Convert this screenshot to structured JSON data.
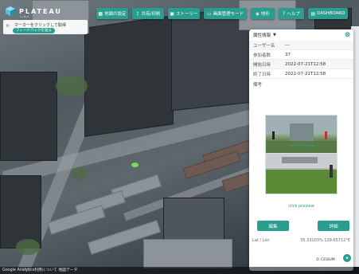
{
  "app": {
    "logo_text": "PLATEAU",
    "logo_sub": "by MLIT"
  },
  "toolbar": {
    "buttons": [
      {
        "label": "地図の設定",
        "icon": "map-icon"
      },
      {
        "label": "共有/印刷",
        "icon": "share-icon"
      },
      {
        "label": "ストーリー",
        "icon": "story-icon"
      },
      {
        "label": "画面管理モード",
        "icon": "screen-icon"
      },
      {
        "label": "地形",
        "icon": "terrain-icon"
      },
      {
        "label": "ヘルプ",
        "icon": "help-icon"
      },
      {
        "label": "DASHBOARD",
        "icon": "dashboard-icon"
      }
    ]
  },
  "tooltip": {
    "text": "マーカーをクリックして取得",
    "pill": "フィードバックを送る"
  },
  "panel": {
    "title": "属性情報",
    "rows": [
      {
        "key": "ユーザー名",
        "value": "---"
      },
      {
        "key": "参加者数",
        "value": "37"
      },
      {
        "key": "開始日時",
        "value": "2022-07-21T12:58"
      },
      {
        "key": "終了日時",
        "value": "2022-07-21T12:58"
      }
    ],
    "section_label": "備考",
    "photo1_caption": "click preview",
    "photo2_caption": "click preview",
    "edit_button": "編集",
    "detail_button": "詳細",
    "latlon_label": "Lat / Lon",
    "latlon_value": "35.33103%  139.65712°E"
  },
  "footer": {
    "attribution": "Google Analytics利用について  地図データ",
    "copyright": "© CESIUM"
  },
  "colors": {
    "accent": "#2a9d8f"
  }
}
